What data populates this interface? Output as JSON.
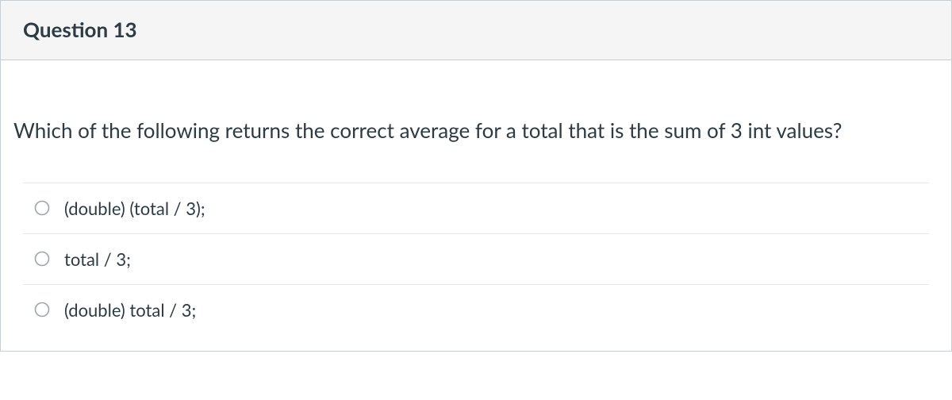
{
  "question": {
    "title": "Question 13",
    "text": "Which of the following returns the correct average for a total that is the sum of 3 int values?",
    "answers": [
      {
        "label": "(double) (total / 3);"
      },
      {
        "label": "total / 3;"
      },
      {
        "label": "(double) total / 3;"
      }
    ]
  }
}
